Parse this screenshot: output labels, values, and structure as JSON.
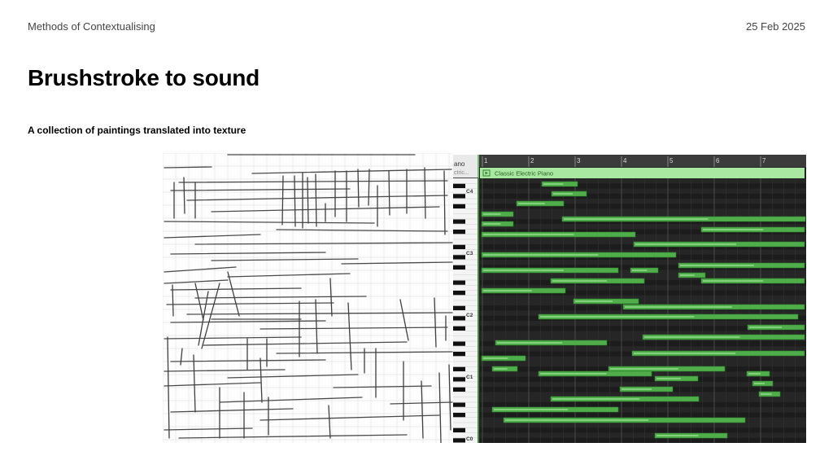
{
  "header": {
    "course": "Methods of Contextualising",
    "date": "25 Feb 2025"
  },
  "slide": {
    "title": "Brushstroke to sound",
    "subtitle": "A collection of paintings translated into texture"
  },
  "daw": {
    "track_name_partial": "ano",
    "track_subname_partial": "ctric...",
    "region_name": "Classic Electric Piano",
    "bar_numbers": [
      "1",
      "2",
      "3",
      "4",
      "5",
      "6",
      "7"
    ],
    "octave_labels": [
      "C4",
      "C3",
      "C2",
      "C1",
      "C0"
    ],
    "colors": {
      "background": "#232323",
      "ruler": "#3b3b3b",
      "region_header": "#a8e8a0",
      "note": "#4fae4a",
      "note_border": "#2e7d2b",
      "velocity_line": "#b6f2ae"
    }
  }
}
